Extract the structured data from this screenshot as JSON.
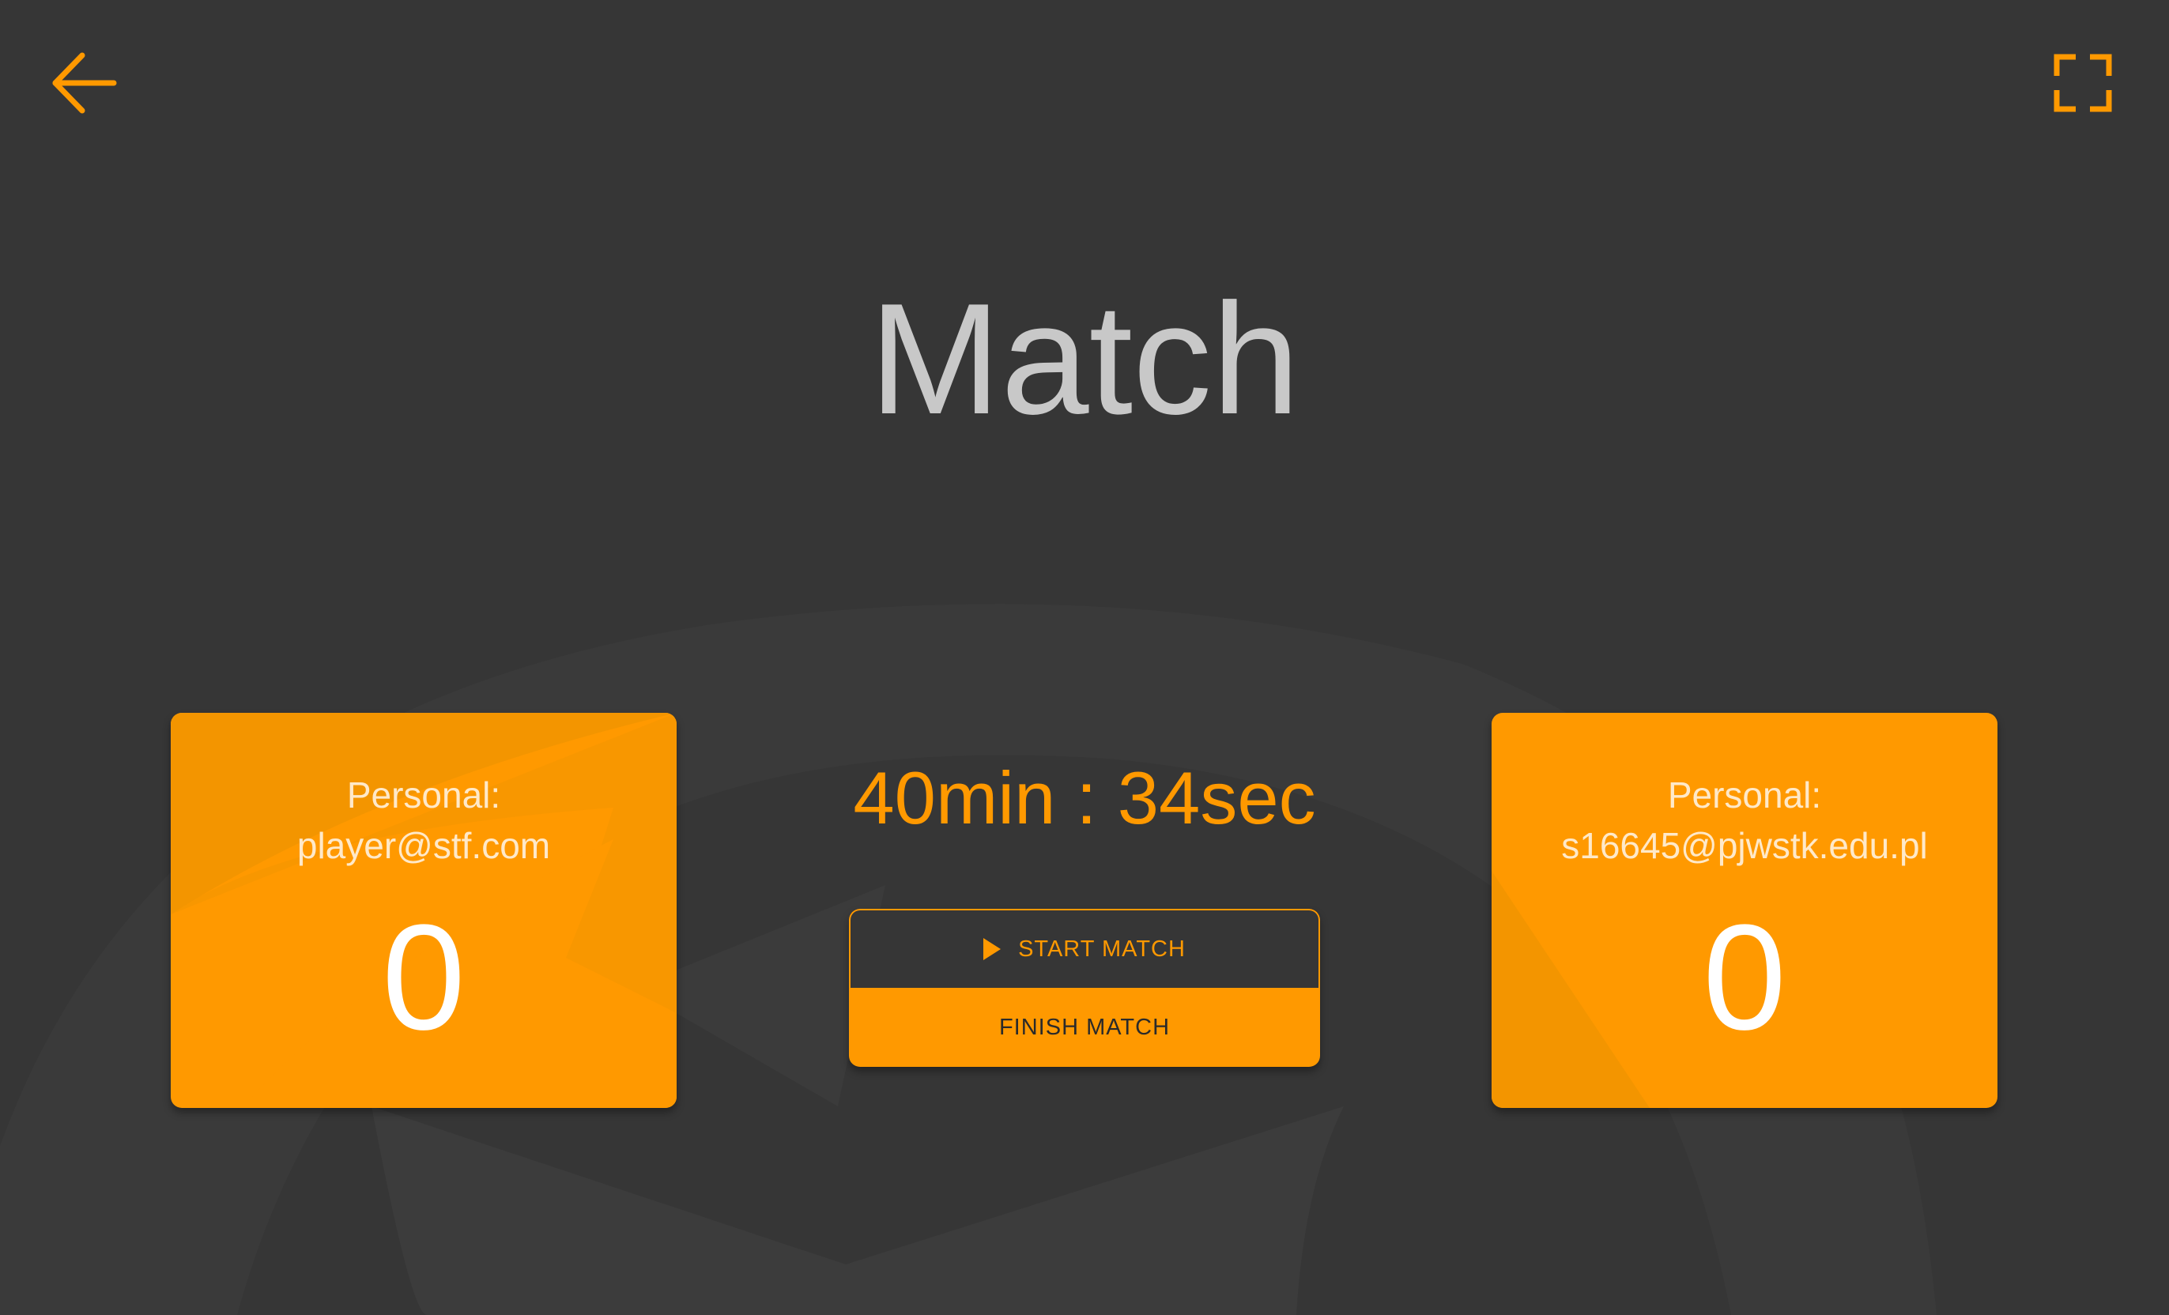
{
  "colors": {
    "background": "#363636",
    "accent": "#ff9900",
    "title": "#c8c8c8"
  },
  "header": {
    "back_icon": "arrow-left-icon",
    "fullscreen_icon": "fullscreen-icon",
    "title": "Match"
  },
  "players": [
    {
      "label": "Personal:",
      "email": "player@stf.com",
      "score": "0"
    },
    {
      "label": "Personal:",
      "email": "s16645@pjwstk.edu.pl",
      "score": "0"
    }
  ],
  "timer": "40min : 34sec",
  "controls": {
    "start_label": "START MATCH",
    "start_icon": "play-icon",
    "finish_label": "FINISH MATCH"
  }
}
